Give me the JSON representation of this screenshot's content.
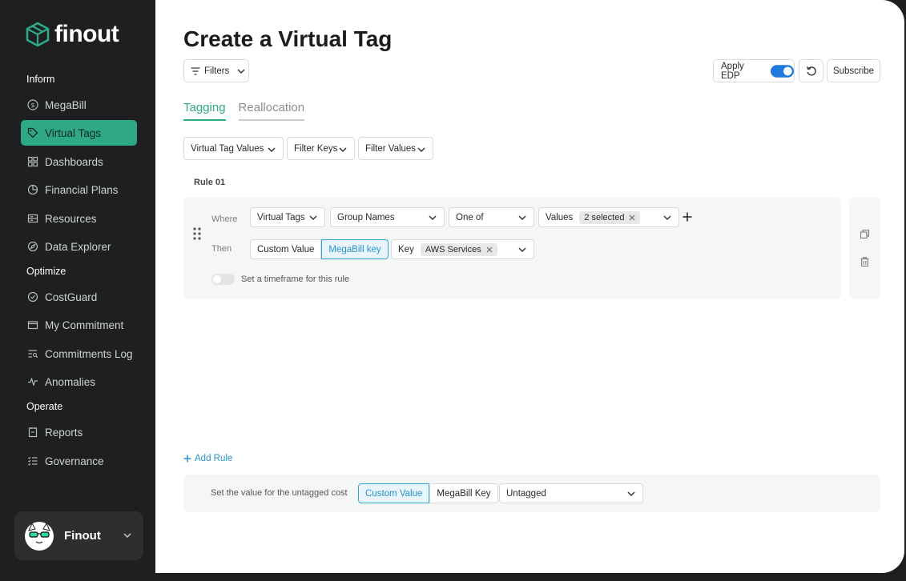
{
  "brand": {
    "name": "finout",
    "accent": "#2fa884"
  },
  "sidebar": {
    "sections": [
      {
        "label": "Inform"
      },
      {
        "label": "Optimize"
      },
      {
        "label": "Operate"
      }
    ],
    "items": [
      {
        "label": "MegaBill",
        "icon": "dollar-circle-icon"
      },
      {
        "label": "Virtual Tags",
        "icon": "tag-icon",
        "active": true
      },
      {
        "label": "Dashboards",
        "icon": "grid-icon"
      },
      {
        "label": "Financial Plans",
        "icon": "pie-icon"
      },
      {
        "label": "Resources",
        "icon": "server-icon"
      },
      {
        "label": "Data Explorer",
        "icon": "compass-icon"
      },
      {
        "label": "CostGuard",
        "icon": "shield-check-icon"
      },
      {
        "label": "My Commitment",
        "icon": "wallet-icon"
      },
      {
        "label": "Commitments Log",
        "icon": "list-search-icon"
      },
      {
        "label": "Anomalies",
        "icon": "pulse-icon"
      },
      {
        "label": "Reports",
        "icon": "report-icon"
      },
      {
        "label": "Governance",
        "icon": "checklist-icon"
      }
    ],
    "user": {
      "name": "Finout"
    }
  },
  "page": {
    "title": "Create a Virtual Tag",
    "filters_label": "Filters",
    "apply_edp_label": "Apply EDP",
    "apply_edp_on": true,
    "subscribe_label": "Subscribe",
    "tabs": [
      {
        "label": "Tagging",
        "active": true
      },
      {
        "label": "Reallocation",
        "active": false
      }
    ],
    "filter_bar": {
      "virtual_tag_values": "Virtual Tag Values",
      "filter_keys": "Filter Keys",
      "filter_values": "Filter Values"
    }
  },
  "rule": {
    "label": "Rule 01",
    "where_label": "Where",
    "then_label": "Then",
    "where": {
      "source": "Virtual Tags",
      "key": "Group Names",
      "operator": "One of",
      "values_label": "Values",
      "values_chip": "2 selected"
    },
    "then": {
      "custom_value": "Custom Value",
      "megabill_key": "MegaBill key",
      "key_label": "Key",
      "key_chip": "AWS Services"
    },
    "timeframe_label": "Set a timeframe for this rule"
  },
  "add_rule_label": "Add Rule",
  "untagged": {
    "label": "Set the value for the untagged cost",
    "custom_value": "Custom Value",
    "megabill_key": "MegaBill Key",
    "value": "Untagged"
  }
}
